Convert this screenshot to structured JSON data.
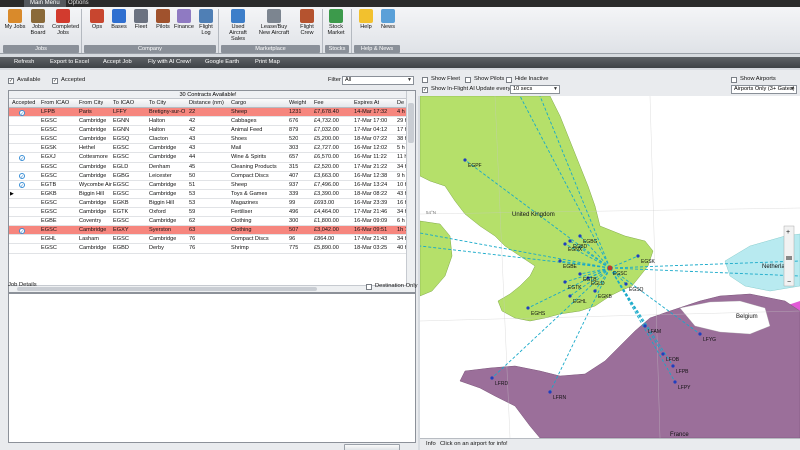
{
  "title_tabs": [
    "Main Menu",
    "Options"
  ],
  "ribbon": {
    "buttons": [
      {
        "label": "My Jobs",
        "icon": "tools-icon",
        "color": "#d98a2b"
      },
      {
        "label": "Jobs Board",
        "icon": "board-icon",
        "color": "#8a6a3a"
      },
      {
        "label": "Completed Jobs",
        "icon": "checkmark-icon",
        "color": "#d23b2e"
      },
      {
        "label": "Ops",
        "icon": "ops-icon",
        "color": "#c8462f"
      },
      {
        "label": "Bases",
        "icon": "globe-icon",
        "color": "#2f6fd0"
      },
      {
        "label": "Fleet",
        "icon": "plane-icon",
        "color": "#6b7280"
      },
      {
        "label": "Pilots",
        "icon": "pilot-icon",
        "color": "#a0522d"
      },
      {
        "label": "Finance",
        "icon": "money-icon",
        "color": "#8f7ac2"
      },
      {
        "label": "Flight Log",
        "icon": "log-icon",
        "color": "#4f7fb5"
      },
      {
        "label": "Used Aircraft Sales",
        "icon": "sales-icon",
        "color": "#3d7ec9"
      },
      {
        "label": "Lease/Buy New Aircraft",
        "icon": "lease-plane-icon",
        "color": "#7c8590"
      },
      {
        "label": "Flight Crew",
        "icon": "crew-icon",
        "color": "#b5532f"
      },
      {
        "label": "Stock Market",
        "icon": "stock-icon",
        "color": "#3c9a4b"
      },
      {
        "label": "Help",
        "icon": "lightbulb-icon",
        "color": "#f2c12e"
      },
      {
        "label": "News",
        "icon": "news-icon",
        "color": "#5aa0d8"
      }
    ],
    "groups": [
      "Jobs",
      "Company",
      "Marketplace",
      "Stocks",
      "Help & News"
    ]
  },
  "toolbar": [
    "Refresh",
    "Export to Excel",
    "Accept Job",
    "Fly with AI Crew!",
    "Google Earth",
    "Print Map"
  ],
  "filters": {
    "available_label": "Available",
    "accepted_label": "Accepted",
    "filter_label": "Filter",
    "filter_value": "All"
  },
  "grid": {
    "caption": "30 Contracts Available!",
    "columns": [
      "Accepted",
      "From ICAO",
      "From City",
      "To ICAO",
      "To City",
      "Distance (nm)",
      "Cargo",
      "Weight",
      "Fee",
      "Expires At",
      "De"
    ],
    "rows": [
      {
        "accepted": true,
        "from_icao": "LFPB",
        "from_city": "Paris",
        "to_icao": "LFFY",
        "to_city": "Bretigny-sur-O",
        "distance": "22",
        "cargo": "Sheep",
        "weight": "1231",
        "fee": "£7,678.40",
        "expires": "14-Mar 17:32",
        "de": "4 h",
        "hl": true
      },
      {
        "accepted": false,
        "from_icao": "EGSC",
        "from_city": "Cambridge",
        "to_icao": "EGNN",
        "to_city": "Halton",
        "distance": "42",
        "cargo": "Cabbages",
        "weight": "676",
        "fee": "£4,732.00",
        "expires": "17-Mar 17:00",
        "de": "29 h",
        "hl": false
      },
      {
        "accepted": false,
        "from_icao": "EGSC",
        "from_city": "Cambridge",
        "to_icao": "EGNN",
        "to_city": "Halton",
        "distance": "42",
        "cargo": "Animal Feed",
        "weight": "879",
        "fee": "£7,032.00",
        "expires": "17-Mar 04:12",
        "de": "17 h",
        "hl": false
      },
      {
        "accepted": false,
        "from_icao": "EGSC",
        "from_city": "Cambridge",
        "to_icao": "EGSQ",
        "to_city": "Clacton",
        "distance": "43",
        "cargo": "Shoes",
        "weight": "520",
        "fee": "£5,200.00",
        "expires": "18-Mar 07:22",
        "de": "38 h",
        "hl": false
      },
      {
        "accepted": false,
        "from_icao": "EGSK",
        "from_city": "Hethel",
        "to_icao": "EGSC",
        "to_city": "Cambridge",
        "distance": "43",
        "cargo": "Mail",
        "weight": "303",
        "fee": "£2,727.00",
        "expires": "16-Mar 12:02",
        "de": "5 h",
        "hl": false
      },
      {
        "accepted": true,
        "from_icao": "EGXJ",
        "from_city": "Cottesmore",
        "to_icao": "EGSC",
        "to_city": "Cambridge",
        "distance": "44",
        "cargo": "Wine & Spirits",
        "weight": "657",
        "fee": "£6,570.00",
        "expires": "16-Mar 11:22",
        "de": "11 h",
        "hl": false
      },
      {
        "accepted": false,
        "from_icao": "EGSC",
        "from_city": "Cambridge",
        "to_icao": "EGLD",
        "to_city": "Denham",
        "distance": "45",
        "cargo": "Cleaning Products",
        "weight": "315",
        "fee": "£2,520.00",
        "expires": "17-Mar 21:22",
        "de": "34 h",
        "hl": false
      },
      {
        "accepted": true,
        "from_icao": "EGSC",
        "from_city": "Cambridge",
        "to_icao": "EGBG",
        "to_city": "Leicester",
        "distance": "50",
        "cargo": "Compact Discs",
        "weight": "407",
        "fee": "£3,663.00",
        "expires": "16-Mar 12:38",
        "de": "9 h",
        "hl": false
      },
      {
        "accepted": true,
        "from_icao": "EGTB",
        "from_city": "Wycombe Air",
        "to_icao": "EGSC",
        "to_city": "Cambridge",
        "distance": "51",
        "cargo": "Sheep",
        "weight": "937",
        "fee": "£7,496.00",
        "expires": "16-Mar 13:24",
        "de": "10 h",
        "hl": false
      },
      {
        "accepted": false,
        "from_icao": "EGKB",
        "from_city": "Biggin Hill",
        "to_icao": "EGSC",
        "to_city": "Cambridge",
        "distance": "53",
        "cargo": "Toys & Games",
        "weight": "339",
        "fee": "£3,390.00",
        "expires": "18-Mar 08:22",
        "de": "43 h",
        "hl": false,
        "current": true
      },
      {
        "accepted": false,
        "from_icao": "EGSC",
        "from_city": "Cambridge",
        "to_icao": "EGKB",
        "to_city": "Biggin Hill",
        "distance": "53",
        "cargo": "Magazines",
        "weight": "99",
        "fee": "£693.00",
        "expires": "16-Mar 23:39",
        "de": "16 h",
        "hl": false
      },
      {
        "accepted": false,
        "from_icao": "EGSC",
        "from_city": "Cambridge",
        "to_icao": "EGTK",
        "to_city": "Oxford",
        "distance": "59",
        "cargo": "Fertiliser",
        "weight": "496",
        "fee": "£4,464.00",
        "expires": "17-Mar 21:46",
        "de": "34 h",
        "hl": false
      },
      {
        "accepted": false,
        "from_icao": "EGBE",
        "from_city": "Coventry",
        "to_icao": "EGSC",
        "to_city": "Cambridge",
        "distance": "62",
        "cargo": "Clothing",
        "weight": "300",
        "fee": "£1,800.00",
        "expires": "16-Mar 09:09",
        "de": "6 h",
        "hl": false
      },
      {
        "accepted": true,
        "from_icao": "EGSC",
        "from_city": "Cambridge",
        "to_icao": "EGXY",
        "to_city": "Syerston",
        "distance": "63",
        "cargo": "Clothing",
        "weight": "507",
        "fee": "£3,042.00",
        "expires": "16-Mar 09:51",
        "de": "1h 1",
        "hl": true
      },
      {
        "accepted": false,
        "from_icao": "EGHL",
        "from_city": "Lasham",
        "to_icao": "EGSC",
        "to_city": "Cambridge",
        "distance": "76",
        "cargo": "Compact Discs",
        "weight": "96",
        "fee": "£864.00",
        "expires": "17-Mar 21:43",
        "de": "34 h",
        "hl": false
      },
      {
        "accepted": false,
        "from_icao": "EGSC",
        "from_city": "Cambridge",
        "to_icao": "EGBD",
        "to_city": "Derby",
        "distance": "76",
        "cargo": "Shrimp",
        "weight": "775",
        "fee": "£5,890.00",
        "expires": "18-Mar 03:25",
        "de": "40 h",
        "hl": false
      }
    ]
  },
  "job_details": {
    "label": "Job Details",
    "destination_only_label": "Destination Only"
  },
  "map_controls": {
    "show_fleet": "Show Fleet",
    "show_pilots": "Show Pilots",
    "hide_inactive": "Hide Inactive",
    "show_airports": "Show Airports",
    "show_inflight": "Show In-Flight AI",
    "update_label": "Update every",
    "update_value": "10 secs",
    "airports_filter": "Airports Only (3+ Gates)"
  },
  "map": {
    "labels": {
      "uk": "United Kingdom",
      "belgium": "Belgium",
      "netherlands": "Netherla",
      "france": "France",
      "lat": "54°N"
    },
    "airports": [
      "EGPF",
      "EGNX",
      "EGBG",
      "EGBD",
      "EGBE",
      "EGTK",
      "EGSC",
      "EGSK",
      "EGSQ",
      "EGKB",
      "EGHL",
      "EGHS",
      "EGLD",
      "EGTB",
      "LFAM",
      "LFYG",
      "LFOB",
      "LFPB",
      "LFPY",
      "LFRD",
      "LFRN"
    ],
    "colors": {
      "sea": "#ffffff",
      "uk": "#b5e06a",
      "france": "#9b6f9a",
      "belgium": "#ffffff",
      "netherlands": "#b8eaf0",
      "route": "#17a9c9"
    }
  },
  "info": {
    "label": "Info",
    "text": "Click on an airport for info!"
  }
}
